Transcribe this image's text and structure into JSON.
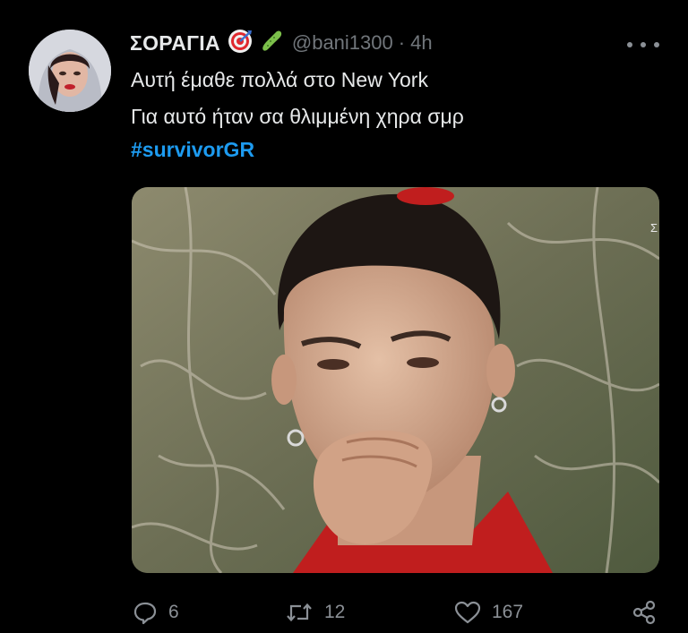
{
  "tweet": {
    "author_name": "ΣΟΡΑΓΙΑ",
    "author_emojis": [
      "target-emoji",
      "cucumber-emoji"
    ],
    "handle": "@bani1300",
    "separator": "·",
    "time": "4h",
    "lines": [
      "Αυτή έμαθε πολλά στο New York",
      "Για αυτό ήταν σα θλιμμένη χηρα σμρ"
    ],
    "hashtag": "#survivorGR",
    "media_corner_mark": "Σ"
  },
  "actions": {
    "replies": "6",
    "retweets": "12",
    "likes": "167"
  },
  "icons": {
    "more": "more-horizontal-icon",
    "reply": "reply-icon",
    "retweet": "retweet-icon",
    "like": "heart-icon",
    "share": "share-icon"
  },
  "colors": {
    "background": "#000000",
    "text": "#e7e9ea",
    "secondary": "#71767b",
    "link": "#1d9bf0"
  }
}
